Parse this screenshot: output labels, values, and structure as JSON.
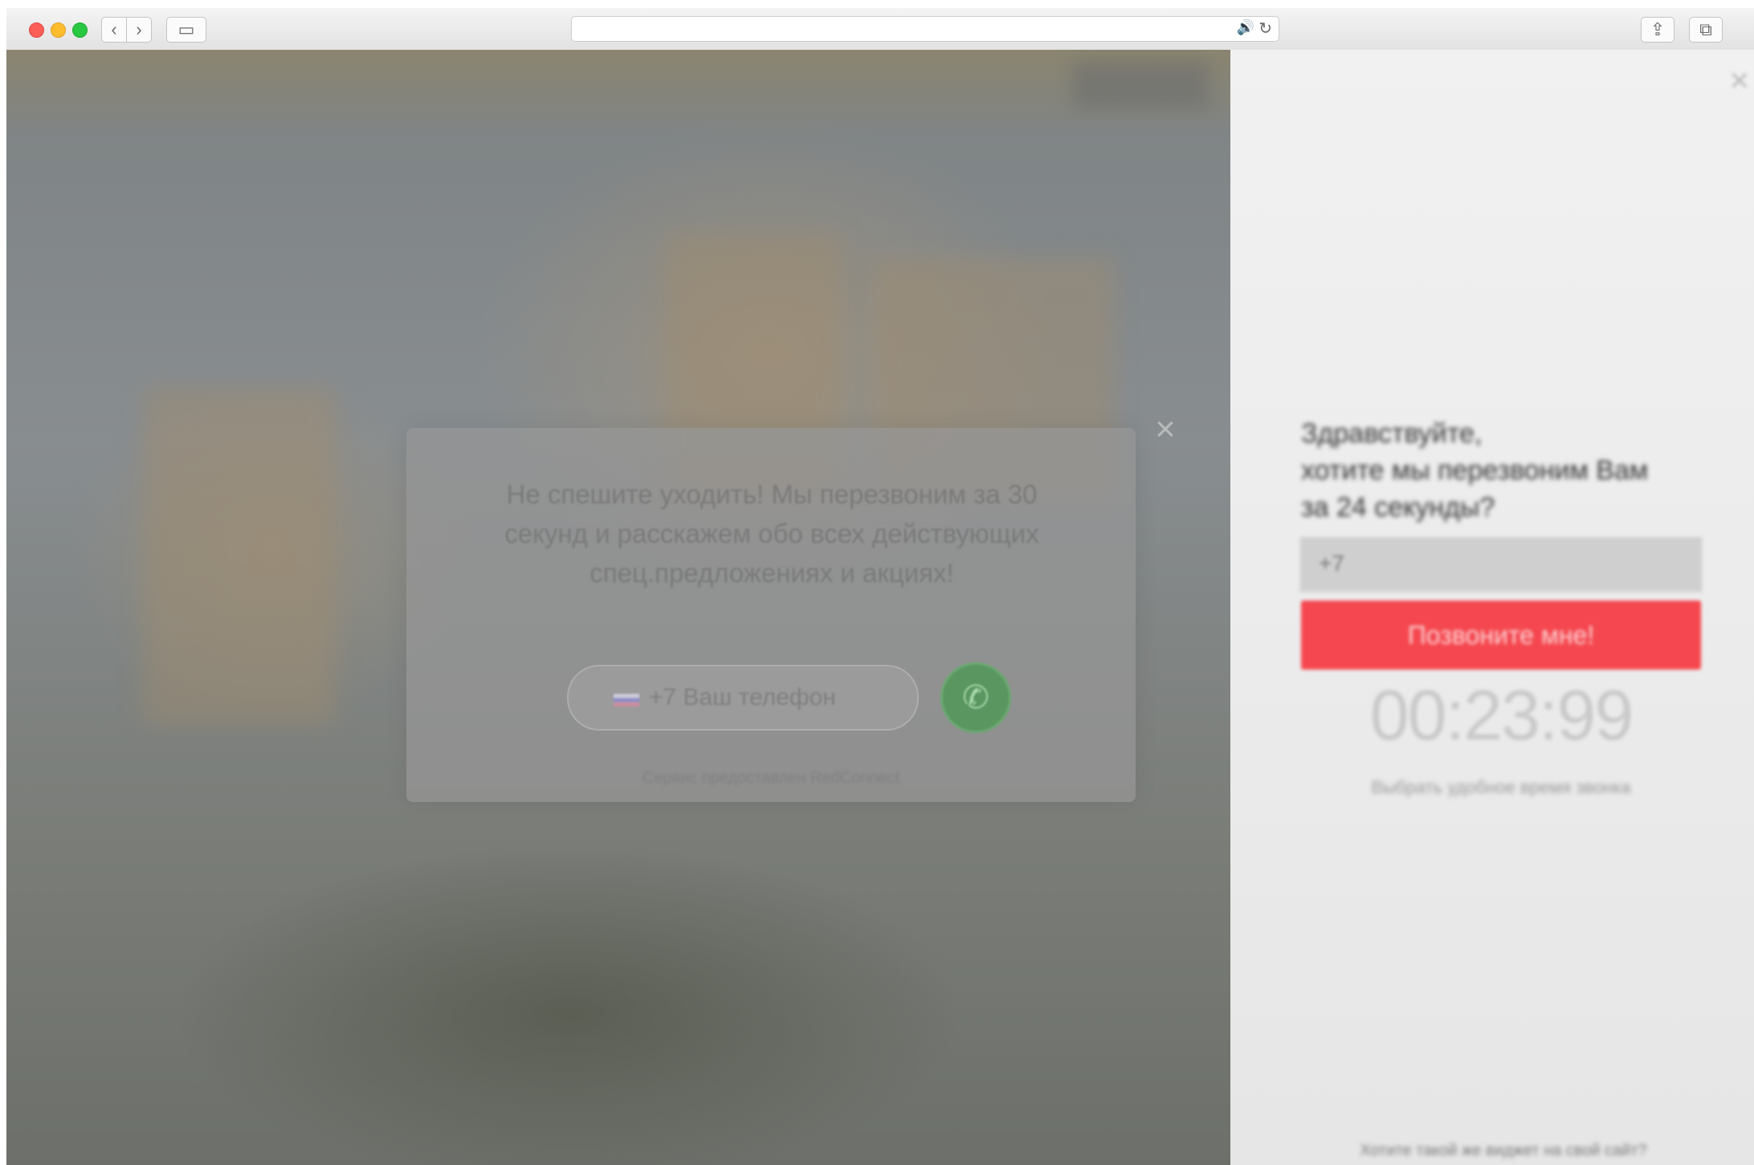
{
  "toolbar": {
    "back_icon": "‹",
    "forward_icon": "›",
    "sidebar_icon": "▭",
    "audio_icon": "🔊",
    "reload_icon": "↻",
    "share_icon": "⇪",
    "tabs_icon": "⧉"
  },
  "modal": {
    "close_icon": "×",
    "message": "Не спешите уходить! Мы перезвоним за 30 секунд и расскажем обо всех действующих спец.предложениях и акциях!",
    "phone_placeholder": "+7 Ваш телефон",
    "call_icon": "✆",
    "powered_by": "Сервис предоставлен RedConnect"
  },
  "panel": {
    "close_icon": "×",
    "greeting_line1": "Здравствуйте,",
    "greeting_line2": "хотите мы перезвоним Вам",
    "greeting_line3": "за 24 секунды?",
    "phone_value": "+7",
    "submit_label": "Позвоните мне!",
    "timer": "00:23:99",
    "note": "Выбрать удобное время звонка",
    "footer": "Хотите такой же виджет на свой сайт?"
  },
  "colors": {
    "submit_bg": "#f5474f",
    "call_bg": "#5a9660"
  }
}
